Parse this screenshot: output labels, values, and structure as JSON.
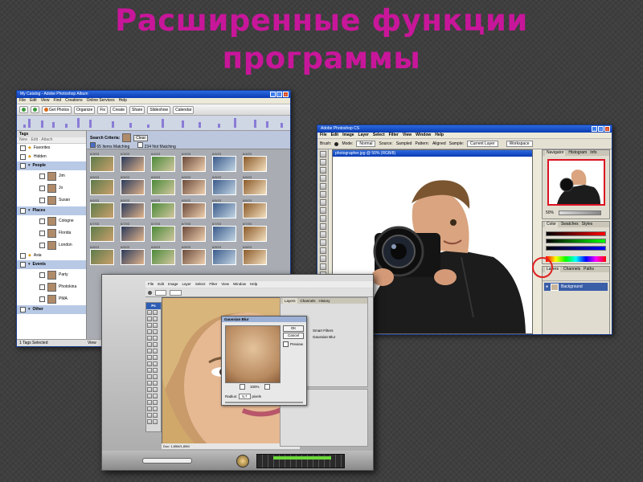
{
  "slide": {
    "title_line1": "Расширенные функции",
    "title_line2": "программы",
    "title_color": "#c8169a"
  },
  "album": {
    "window_title": "My Catalog - Adobe Photoshop Album",
    "menu": [
      "File",
      "Edit",
      "View",
      "Find",
      "Creations",
      "Online Services",
      "Help"
    ],
    "toolbar": [
      "Get Photos",
      "Organize",
      "Fix",
      "Create",
      "Share",
      "Slideshow",
      "Calendar"
    ],
    "tags_header": "Tags",
    "tags_tools": [
      "New",
      "Edit",
      "Attach"
    ],
    "tags": [
      {
        "label": "Favorites",
        "kind": "item"
      },
      {
        "label": "Hidden",
        "kind": "item"
      },
      {
        "label": "People",
        "kind": "cat"
      },
      {
        "label": "Jim",
        "kind": "sub"
      },
      {
        "label": "Jo",
        "kind": "sub"
      },
      {
        "label": "Susan",
        "kind": "sub"
      },
      {
        "label": "Places",
        "kind": "cat"
      },
      {
        "label": "Cologne",
        "kind": "sub"
      },
      {
        "label": "Florida",
        "kind": "sub"
      },
      {
        "label": "London",
        "kind": "sub"
      },
      {
        "label": "Asia",
        "kind": "item"
      },
      {
        "label": "Events",
        "kind": "cat"
      },
      {
        "label": "Party",
        "kind": "sub"
      },
      {
        "label": "Photokina",
        "kind": "sub"
      },
      {
        "label": "PMA",
        "kind": "sub"
      },
      {
        "label": "Other",
        "kind": "cat"
      }
    ],
    "search_criteria": "Search Criteria:",
    "clear_label": "Clear",
    "items_matching": "65 Items Matching",
    "items_not_matching": "234 Not Matching",
    "dates": [
      "6/3/03",
      "6/3/03",
      "6/4/03",
      "6/4/03",
      "6/4/03",
      "6/4/03",
      "6/5/03",
      "6/5/03",
      "6/5/03",
      "6/5/03",
      "6/5/03",
      "6/6/03",
      "6/6/03",
      "6/6/03",
      "6/6/03",
      "6/6/03",
      "6/6/03",
      "6/6/03",
      "6/7/03",
      "6/7/03",
      "6/7/03",
      "6/7/03",
      "6/7/03",
      "6/7/03",
      "6/8/03",
      "6/8/03",
      "6/8/03",
      "6/8/03",
      "6/8/03",
      "6/8/03"
    ],
    "status": "1 Tags Selected",
    "view_label": "View"
  },
  "ps": {
    "window_title": "Adobe Photoshop CS",
    "menu": [
      "File",
      "Edit",
      "Image",
      "Layer",
      "Select",
      "Filter",
      "View",
      "Window",
      "Help"
    ],
    "options": [
      "Brush:",
      "Mode:",
      "Normal",
      "Source:",
      "Sampled",
      "Pattern:",
      "Aligned",
      "Sample:",
      "Current Layer"
    ],
    "workspace": "Workspace",
    "doc_title": "photographer.jpg @ 50% (RGB/8)",
    "navigator_tabs": [
      "Navigator",
      "Histogram",
      "Info"
    ],
    "zoom": "50%",
    "color_tabs": [
      "Color",
      "Swatches",
      "Styles"
    ],
    "layers_tabs": [
      "Layers",
      "Channels",
      "Paths"
    ],
    "layer_name": "Background"
  },
  "blur": {
    "menu": [
      "File",
      "Edit",
      "Image",
      "Layer",
      "Select",
      "Filter",
      "View",
      "Window",
      "Help"
    ],
    "dialog_title": "Gaussian Blur",
    "ok": "OK",
    "cancel": "Cancel",
    "preview": "Preview",
    "zoom": "100%",
    "radius_label": "Radius:",
    "radius_value": "5,7",
    "radius_unit": "pixels",
    "status": "Doc: 1,85M/1,85M",
    "panel_tabs": [
      "Layers",
      "Channels",
      "History"
    ],
    "panel_items": [
      "Smart Filters",
      "Gaussian Blur"
    ],
    "ps_logo": "Ps"
  }
}
